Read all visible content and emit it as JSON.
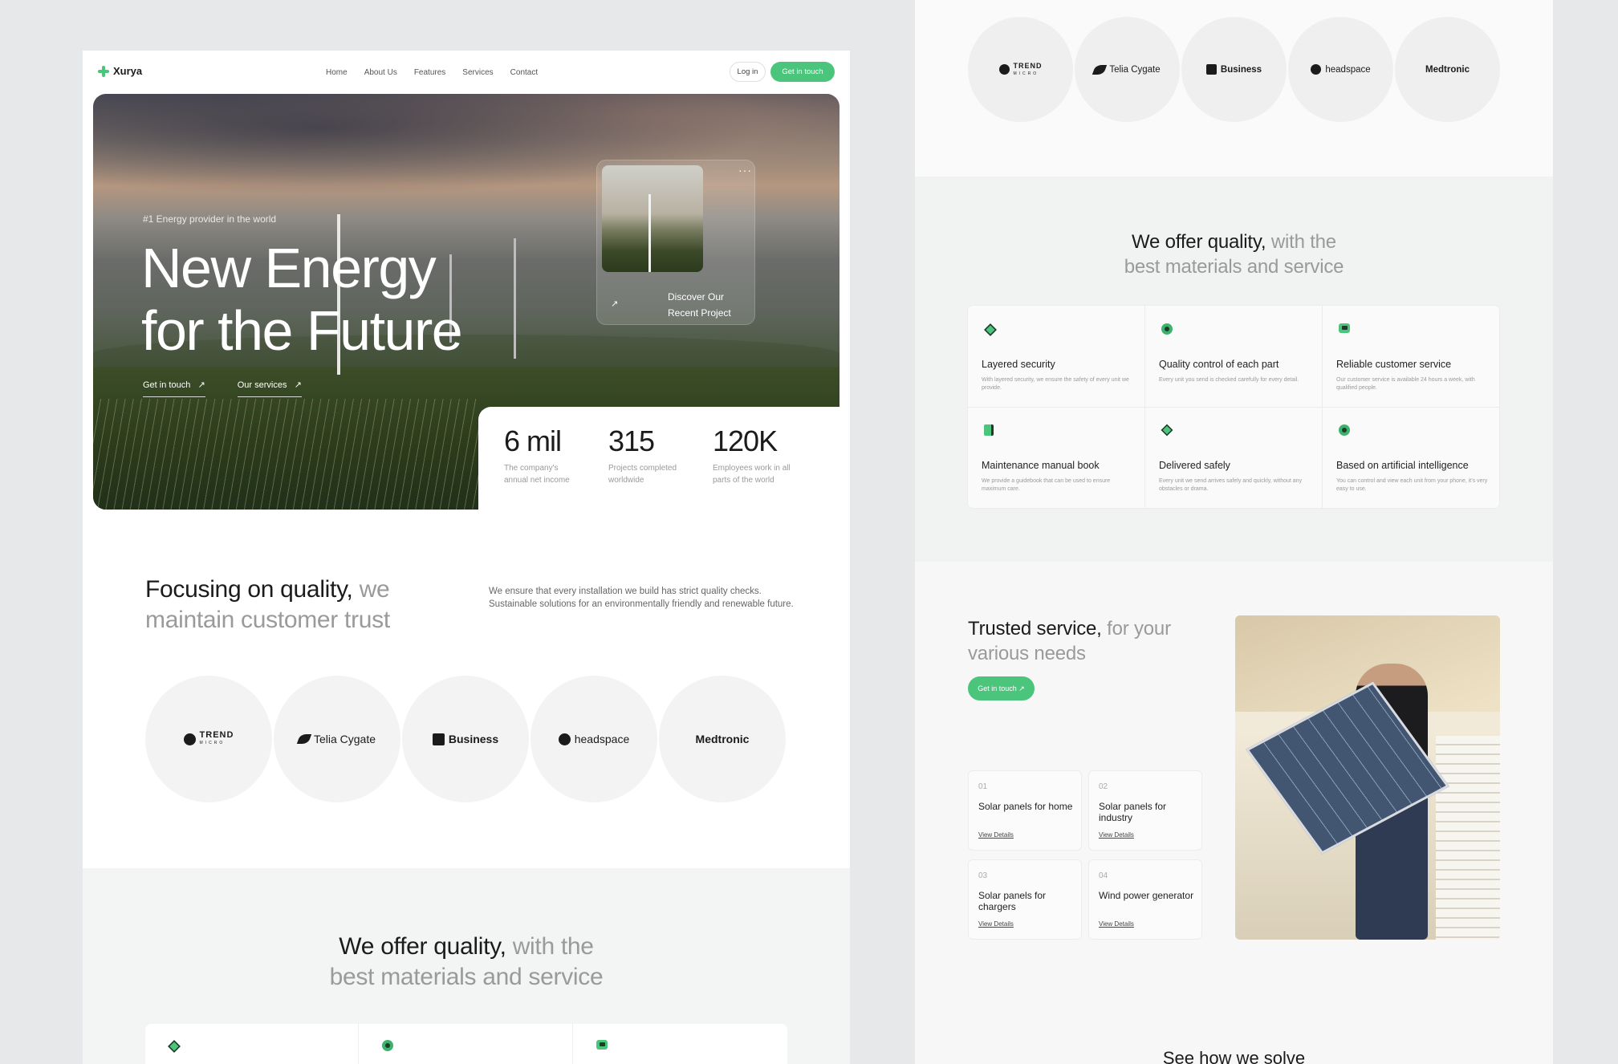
{
  "left": {
    "nav": {
      "brand": "Xurya",
      "links": [
        "Home",
        "About Us",
        "Features",
        "Services",
        "Contact"
      ],
      "login": "Log in",
      "cta": "Get in touch"
    },
    "hero": {
      "tag": "#1 Energy provider in the world",
      "title_line1": "New Energy",
      "title_line2": "for the Future",
      "link1": "Get in touch",
      "link2": "Our services",
      "card_text_line1": "Discover Our",
      "card_text_line2": "Recent Project",
      "card_dots": "···",
      "arrow": "↗"
    },
    "stats": [
      {
        "num": "6 mil",
        "lbl1": "The company's",
        "lbl2": "annual net income"
      },
      {
        "num": "315",
        "lbl1": "Projects completed",
        "lbl2": "worldwide"
      },
      {
        "num": "120K",
        "lbl1": "Employees work in all",
        "lbl2": "parts of the world"
      }
    ],
    "focus": {
      "h_dark": "Focusing on quality,",
      "h_muted1": "we",
      "h_muted2": "maintain customer trust",
      "p": "We ensure that every installation we build has strict quality checks. Sustainable solutions for an environmentally friendly and renewable future."
    },
    "logos": [
      {
        "name": "TREND",
        "sub": "MICRO"
      },
      {
        "name": "Telia Cygate"
      },
      {
        "name": "Business"
      },
      {
        "name": "headspace"
      },
      {
        "name": "Medtronic"
      }
    ],
    "offer": {
      "h_dark": "We offer quality,",
      "h_muted1": "with the",
      "h_muted2": "best materials and service"
    }
  },
  "right": {
    "offer": {
      "h_dark": "We offer quality,",
      "h_muted1": "with the",
      "h_muted2": "best materials and service"
    },
    "features": [
      {
        "title": "Layered security",
        "desc": "With layered security, we ensure the safety of every unit we provide.",
        "icon": "layers-icon"
      },
      {
        "title": "Quality control of each part",
        "desc": "Every unit you send is checked carefully for every detail.",
        "icon": "check-badge-icon"
      },
      {
        "title": "Reliable customer service",
        "desc": "Our customer service is available 24 hours a week, with qualified people.",
        "icon": "chat-icon"
      },
      {
        "title": "Maintenance manual book",
        "desc": "We provide a guidebook that can be used to ensure maximum care.",
        "icon": "book-icon"
      },
      {
        "title": "Delivered safely",
        "desc": "Every unit we send arrives safely and quickly, without any obstacles or drama.",
        "icon": "box-icon"
      },
      {
        "title": "Based on artificial intelligence",
        "desc": "You can control and view each unit from your phone, it's very easy to use.",
        "icon": "ai-icon"
      }
    ],
    "trust": {
      "h_dark": "Trusted service,",
      "h_muted1": "for your",
      "h_muted2": "various needs",
      "cta": "Get in touch ↗"
    },
    "services": [
      {
        "n": "01",
        "title": "Solar panels for home",
        "link": "View Details"
      },
      {
        "n": "02",
        "title": "Solar panels for industry",
        "link": "View Details"
      },
      {
        "n": "03",
        "title": "Solar panels for chargers",
        "link": "View Details"
      },
      {
        "n": "04",
        "title": "Wind power generator",
        "link": "View Details"
      }
    ],
    "see": "See how we solve"
  },
  "colors": {
    "accent": "#4cc57c",
    "text": "#1b1b1b",
    "muted": "#9a9a9a"
  }
}
